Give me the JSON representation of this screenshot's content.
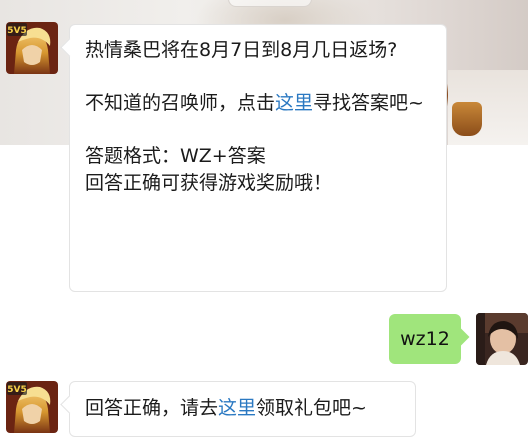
{
  "messages": [
    {
      "sender": "game-account",
      "question": "热情桑巴将在8月7日到8月几日返场?",
      "guide_before": "不知道的召唤师，点击",
      "guide_link": "这里",
      "guide_after": "寻找答案吧~",
      "format_line": "答题格式：WZ+答案",
      "reward_line": "回答正确可获得游戏奖励哦！"
    },
    {
      "sender": "user",
      "text": "wz12"
    },
    {
      "sender": "game-account",
      "before": "回答正确，请去",
      "link": "这里",
      "after": "领取礼包吧~"
    }
  ],
  "avatars": {
    "game_badge_text": "5V5",
    "game_icon": "hero-avatar-icon",
    "user_icon": "user-photo-avatar"
  },
  "colors": {
    "link": "#2b79c2",
    "user_bubble": "#a0e57c",
    "bot_bubble": "#ffffff"
  }
}
